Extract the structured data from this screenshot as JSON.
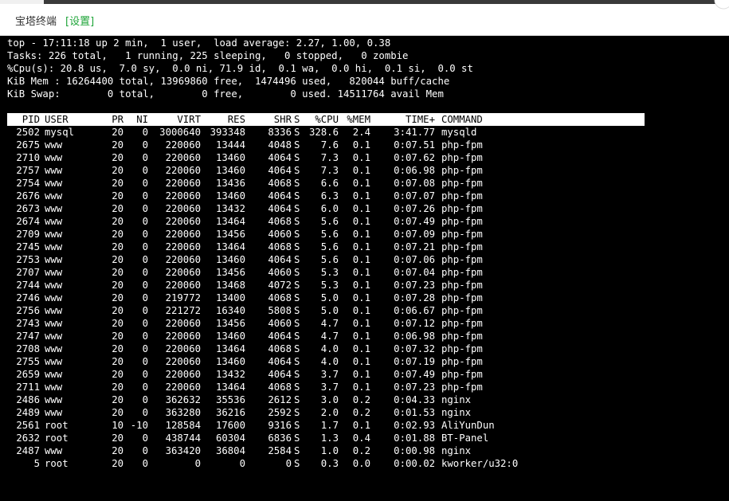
{
  "header": {
    "title": "宝塔终端",
    "settings_label": "[设置]"
  },
  "summary": {
    "line1": "top - 17:11:18 up 2 min,  1 user,  load average: 2.27, 1.00, 0.38",
    "line2": "Tasks: 226 total,   1 running, 225 sleeping,   0 stopped,   0 zombie",
    "line3": "%Cpu(s): 20.8 us,  7.0 sy,  0.0 ni, 71.9 id,  0.1 wa,  0.0 hi,  0.1 si,  0.0 st",
    "line4": "KiB Mem : 16264400 total, 13969860 free,  1474496 used,   820044 buff/cache",
    "line5": "KiB Swap:        0 total,        0 free,        0 used. 14511764 avail Mem"
  },
  "table": {
    "columns": {
      "pid": "PID",
      "user": "USER",
      "pr": "PR",
      "ni": "NI",
      "virt": "VIRT",
      "res": "RES",
      "shr": "SHR",
      "s": "S",
      "cpu": "%CPU",
      "mem": "%MEM",
      "time": "TIME+",
      "cmd": "COMMAND"
    },
    "rows": [
      {
        "pid": "2502",
        "user": "mysql",
        "pr": "20",
        "ni": "0",
        "virt": "3000640",
        "res": "393348",
        "shr": "8336",
        "s": "S",
        "cpu": "328.6",
        "mem": "2.4",
        "time": "3:41.77",
        "cmd": "mysqld"
      },
      {
        "pid": "2675",
        "user": "www",
        "pr": "20",
        "ni": "0",
        "virt": "220060",
        "res": "13444",
        "shr": "4048",
        "s": "S",
        "cpu": "7.6",
        "mem": "0.1",
        "time": "0:07.51",
        "cmd": "php-fpm"
      },
      {
        "pid": "2710",
        "user": "www",
        "pr": "20",
        "ni": "0",
        "virt": "220060",
        "res": "13460",
        "shr": "4064",
        "s": "S",
        "cpu": "7.3",
        "mem": "0.1",
        "time": "0:07.62",
        "cmd": "php-fpm"
      },
      {
        "pid": "2757",
        "user": "www",
        "pr": "20",
        "ni": "0",
        "virt": "220060",
        "res": "13460",
        "shr": "4064",
        "s": "S",
        "cpu": "7.3",
        "mem": "0.1",
        "time": "0:06.98",
        "cmd": "php-fpm"
      },
      {
        "pid": "2754",
        "user": "www",
        "pr": "20",
        "ni": "0",
        "virt": "220060",
        "res": "13436",
        "shr": "4068",
        "s": "S",
        "cpu": "6.6",
        "mem": "0.1",
        "time": "0:07.08",
        "cmd": "php-fpm"
      },
      {
        "pid": "2676",
        "user": "www",
        "pr": "20",
        "ni": "0",
        "virt": "220060",
        "res": "13460",
        "shr": "4064",
        "s": "S",
        "cpu": "6.3",
        "mem": "0.1",
        "time": "0:07.07",
        "cmd": "php-fpm"
      },
      {
        "pid": "2673",
        "user": "www",
        "pr": "20",
        "ni": "0",
        "virt": "220060",
        "res": "13432",
        "shr": "4064",
        "s": "S",
        "cpu": "6.0",
        "mem": "0.1",
        "time": "0:07.26",
        "cmd": "php-fpm"
      },
      {
        "pid": "2674",
        "user": "www",
        "pr": "20",
        "ni": "0",
        "virt": "220060",
        "res": "13464",
        "shr": "4068",
        "s": "S",
        "cpu": "5.6",
        "mem": "0.1",
        "time": "0:07.49",
        "cmd": "php-fpm"
      },
      {
        "pid": "2709",
        "user": "www",
        "pr": "20",
        "ni": "0",
        "virt": "220060",
        "res": "13456",
        "shr": "4060",
        "s": "S",
        "cpu": "5.6",
        "mem": "0.1",
        "time": "0:07.09",
        "cmd": "php-fpm"
      },
      {
        "pid": "2745",
        "user": "www",
        "pr": "20",
        "ni": "0",
        "virt": "220060",
        "res": "13464",
        "shr": "4068",
        "s": "S",
        "cpu": "5.6",
        "mem": "0.1",
        "time": "0:07.21",
        "cmd": "php-fpm"
      },
      {
        "pid": "2753",
        "user": "www",
        "pr": "20",
        "ni": "0",
        "virt": "220060",
        "res": "13460",
        "shr": "4064",
        "s": "S",
        "cpu": "5.6",
        "mem": "0.1",
        "time": "0:07.06",
        "cmd": "php-fpm"
      },
      {
        "pid": "2707",
        "user": "www",
        "pr": "20",
        "ni": "0",
        "virt": "220060",
        "res": "13456",
        "shr": "4060",
        "s": "S",
        "cpu": "5.3",
        "mem": "0.1",
        "time": "0:07.04",
        "cmd": "php-fpm"
      },
      {
        "pid": "2744",
        "user": "www",
        "pr": "20",
        "ni": "0",
        "virt": "220060",
        "res": "13468",
        "shr": "4072",
        "s": "S",
        "cpu": "5.3",
        "mem": "0.1",
        "time": "0:07.23",
        "cmd": "php-fpm"
      },
      {
        "pid": "2746",
        "user": "www",
        "pr": "20",
        "ni": "0",
        "virt": "219772",
        "res": "13400",
        "shr": "4068",
        "s": "S",
        "cpu": "5.0",
        "mem": "0.1",
        "time": "0:07.28",
        "cmd": "php-fpm"
      },
      {
        "pid": "2756",
        "user": "www",
        "pr": "20",
        "ni": "0",
        "virt": "221272",
        "res": "16340",
        "shr": "5808",
        "s": "S",
        "cpu": "5.0",
        "mem": "0.1",
        "time": "0:06.67",
        "cmd": "php-fpm"
      },
      {
        "pid": "2743",
        "user": "www",
        "pr": "20",
        "ni": "0",
        "virt": "220060",
        "res": "13456",
        "shr": "4060",
        "s": "S",
        "cpu": "4.7",
        "mem": "0.1",
        "time": "0:07.12",
        "cmd": "php-fpm"
      },
      {
        "pid": "2747",
        "user": "www",
        "pr": "20",
        "ni": "0",
        "virt": "220060",
        "res": "13460",
        "shr": "4064",
        "s": "S",
        "cpu": "4.7",
        "mem": "0.1",
        "time": "0:06.98",
        "cmd": "php-fpm"
      },
      {
        "pid": "2708",
        "user": "www",
        "pr": "20",
        "ni": "0",
        "virt": "220060",
        "res": "13464",
        "shr": "4068",
        "s": "S",
        "cpu": "4.0",
        "mem": "0.1",
        "time": "0:07.32",
        "cmd": "php-fpm"
      },
      {
        "pid": "2755",
        "user": "www",
        "pr": "20",
        "ni": "0",
        "virt": "220060",
        "res": "13460",
        "shr": "4064",
        "s": "S",
        "cpu": "4.0",
        "mem": "0.1",
        "time": "0:07.19",
        "cmd": "php-fpm"
      },
      {
        "pid": "2659",
        "user": "www",
        "pr": "20",
        "ni": "0",
        "virt": "220060",
        "res": "13432",
        "shr": "4064",
        "s": "S",
        "cpu": "3.7",
        "mem": "0.1",
        "time": "0:07.49",
        "cmd": "php-fpm"
      },
      {
        "pid": "2711",
        "user": "www",
        "pr": "20",
        "ni": "0",
        "virt": "220060",
        "res": "13464",
        "shr": "4068",
        "s": "S",
        "cpu": "3.7",
        "mem": "0.1",
        "time": "0:07.23",
        "cmd": "php-fpm"
      },
      {
        "pid": "2486",
        "user": "www",
        "pr": "20",
        "ni": "0",
        "virt": "362632",
        "res": "35536",
        "shr": "2612",
        "s": "S",
        "cpu": "3.0",
        "mem": "0.2",
        "time": "0:04.33",
        "cmd": "nginx"
      },
      {
        "pid": "2489",
        "user": "www",
        "pr": "20",
        "ni": "0",
        "virt": "363280",
        "res": "36216",
        "shr": "2592",
        "s": "S",
        "cpu": "2.0",
        "mem": "0.2",
        "time": "0:01.53",
        "cmd": "nginx"
      },
      {
        "pid": "2561",
        "user": "root",
        "pr": "10",
        "ni": "-10",
        "virt": "128584",
        "res": "17600",
        "shr": "9316",
        "s": "S",
        "cpu": "1.7",
        "mem": "0.1",
        "time": "0:02.93",
        "cmd": "AliYunDun"
      },
      {
        "pid": "2632",
        "user": "root",
        "pr": "20",
        "ni": "0",
        "virt": "438744",
        "res": "60304",
        "shr": "6836",
        "s": "S",
        "cpu": "1.3",
        "mem": "0.4",
        "time": "0:01.88",
        "cmd": "BT-Panel"
      },
      {
        "pid": "2487",
        "user": "www",
        "pr": "20",
        "ni": "0",
        "virt": "363420",
        "res": "36804",
        "shr": "2584",
        "s": "S",
        "cpu": "1.0",
        "mem": "0.2",
        "time": "0:00.98",
        "cmd": "nginx"
      },
      {
        "pid": "5",
        "user": "root",
        "pr": "20",
        "ni": "0",
        "virt": "0",
        "res": "0",
        "shr": "0",
        "s": "S",
        "cpu": "0.3",
        "mem": "0.0",
        "time": "0:00.02",
        "cmd": "kworker/u32:0"
      }
    ]
  }
}
